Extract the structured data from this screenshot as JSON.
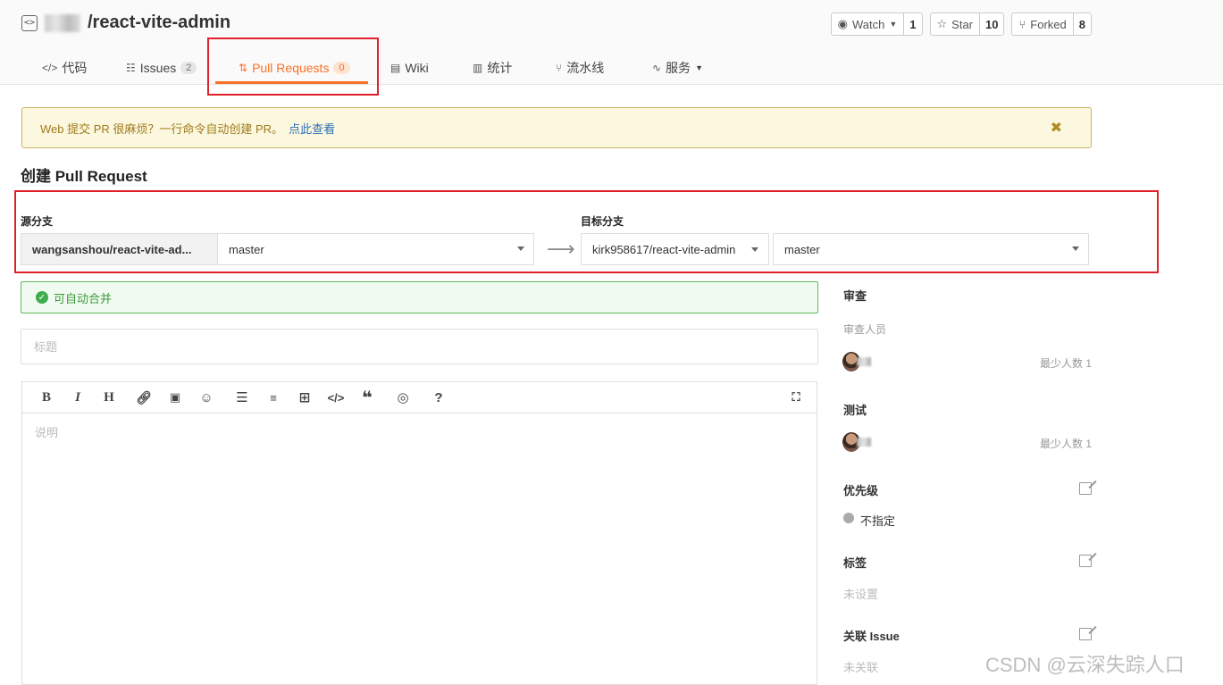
{
  "repo": {
    "name": "/react-vite-admin",
    "watch_label": "Watch",
    "watch_count": "1",
    "star_label": "Star",
    "star_count": "10",
    "fork_label": "Forked",
    "fork_count": "8"
  },
  "tabs": [
    {
      "label": "代码",
      "icon": "code-icon"
    },
    {
      "label": "Issues",
      "badge": "2",
      "icon": "issues-icon"
    },
    {
      "label": "Pull Requests",
      "badge": "0",
      "icon": "pull-request-icon",
      "active": true
    },
    {
      "label": "Wiki",
      "icon": "wiki-icon"
    },
    {
      "label": "统计",
      "icon": "chart-icon"
    },
    {
      "label": "流水线",
      "icon": "pipeline-icon"
    },
    {
      "label": "服务",
      "icon": "pulse-icon"
    }
  ],
  "notice": {
    "text": "Web 提交 PR 很麻烦？一行命令自动创建 PR。",
    "link": "点此查看"
  },
  "page_title": "创建 Pull Request",
  "source": {
    "label": "源分支",
    "repo": "wangsanshou/react-vite-ad...",
    "branch": "master"
  },
  "target": {
    "label": "目标分支",
    "repo": "kirk958617/react-vite-admin",
    "branch": "master"
  },
  "merge_status": "可自动合并",
  "title_placeholder": "标题",
  "description_placeholder": "说明",
  "sidebar": {
    "review_heading": "审查",
    "reviewers_label": "审查人员",
    "review_min": "最少人数 1",
    "test_heading": "测试",
    "test_min": "最少人数 1",
    "priority_heading": "优先级",
    "priority_value": "不指定",
    "tags_heading": "标签",
    "tags_value": "未设置",
    "issue_heading": "关联 Issue",
    "issue_value": "未关联"
  },
  "watermark": "CSDN @云深失踪人口",
  "colors": {
    "accent": "#fa7026",
    "success": "#3fad4f",
    "highlight": "#e0202a"
  }
}
